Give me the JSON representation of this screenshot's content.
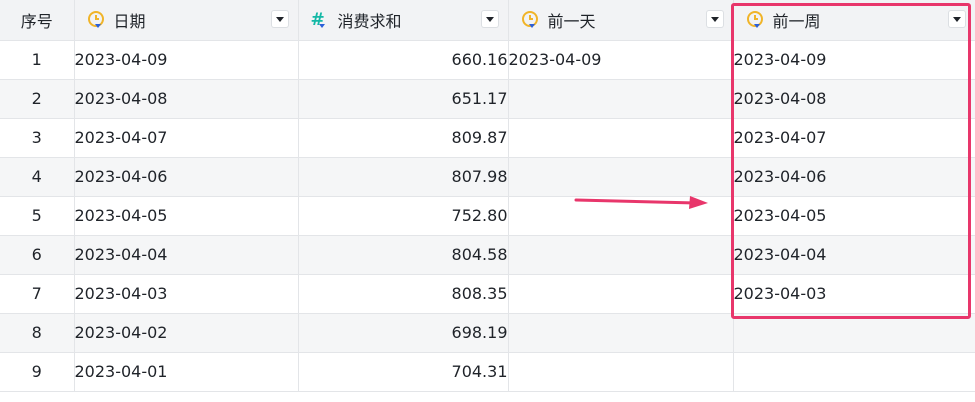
{
  "columns": [
    {
      "label": "序号",
      "icon": "none"
    },
    {
      "label": "日期",
      "icon": "clock-icon"
    },
    {
      "label": "消费求和",
      "icon": "hash-icon"
    },
    {
      "label": "前一天",
      "icon": "clock-icon"
    },
    {
      "label": "前一周",
      "icon": "clock-icon"
    }
  ],
  "rows": [
    {
      "seq": "1",
      "date": "2023-04-09",
      "sum": "660.16",
      "prev_day": "2023-04-09",
      "prev_week": "2023-04-09"
    },
    {
      "seq": "2",
      "date": "2023-04-08",
      "sum": "651.17",
      "prev_day": "",
      "prev_week": "2023-04-08"
    },
    {
      "seq": "3",
      "date": "2023-04-07",
      "sum": "809.87",
      "prev_day": "",
      "prev_week": "2023-04-07"
    },
    {
      "seq": "4",
      "date": "2023-04-06",
      "sum": "807.98",
      "prev_day": "",
      "prev_week": "2023-04-06"
    },
    {
      "seq": "5",
      "date": "2023-04-05",
      "sum": "752.80",
      "prev_day": "",
      "prev_week": "2023-04-05"
    },
    {
      "seq": "6",
      "date": "2023-04-04",
      "sum": "804.58",
      "prev_day": "",
      "prev_week": "2023-04-04"
    },
    {
      "seq": "7",
      "date": "2023-04-03",
      "sum": "808.35",
      "prev_day": "",
      "prev_week": "2023-04-03"
    },
    {
      "seq": "8",
      "date": "2023-04-02",
      "sum": "698.19",
      "prev_day": "",
      "prev_week": ""
    },
    {
      "seq": "9",
      "date": "2023-04-01",
      "sum": "704.31",
      "prev_day": "",
      "prev_week": ""
    }
  ],
  "colors": {
    "highlight": "#e8366b",
    "clock_icon": "#f0b429",
    "hash_icon": "#14b8a6"
  }
}
